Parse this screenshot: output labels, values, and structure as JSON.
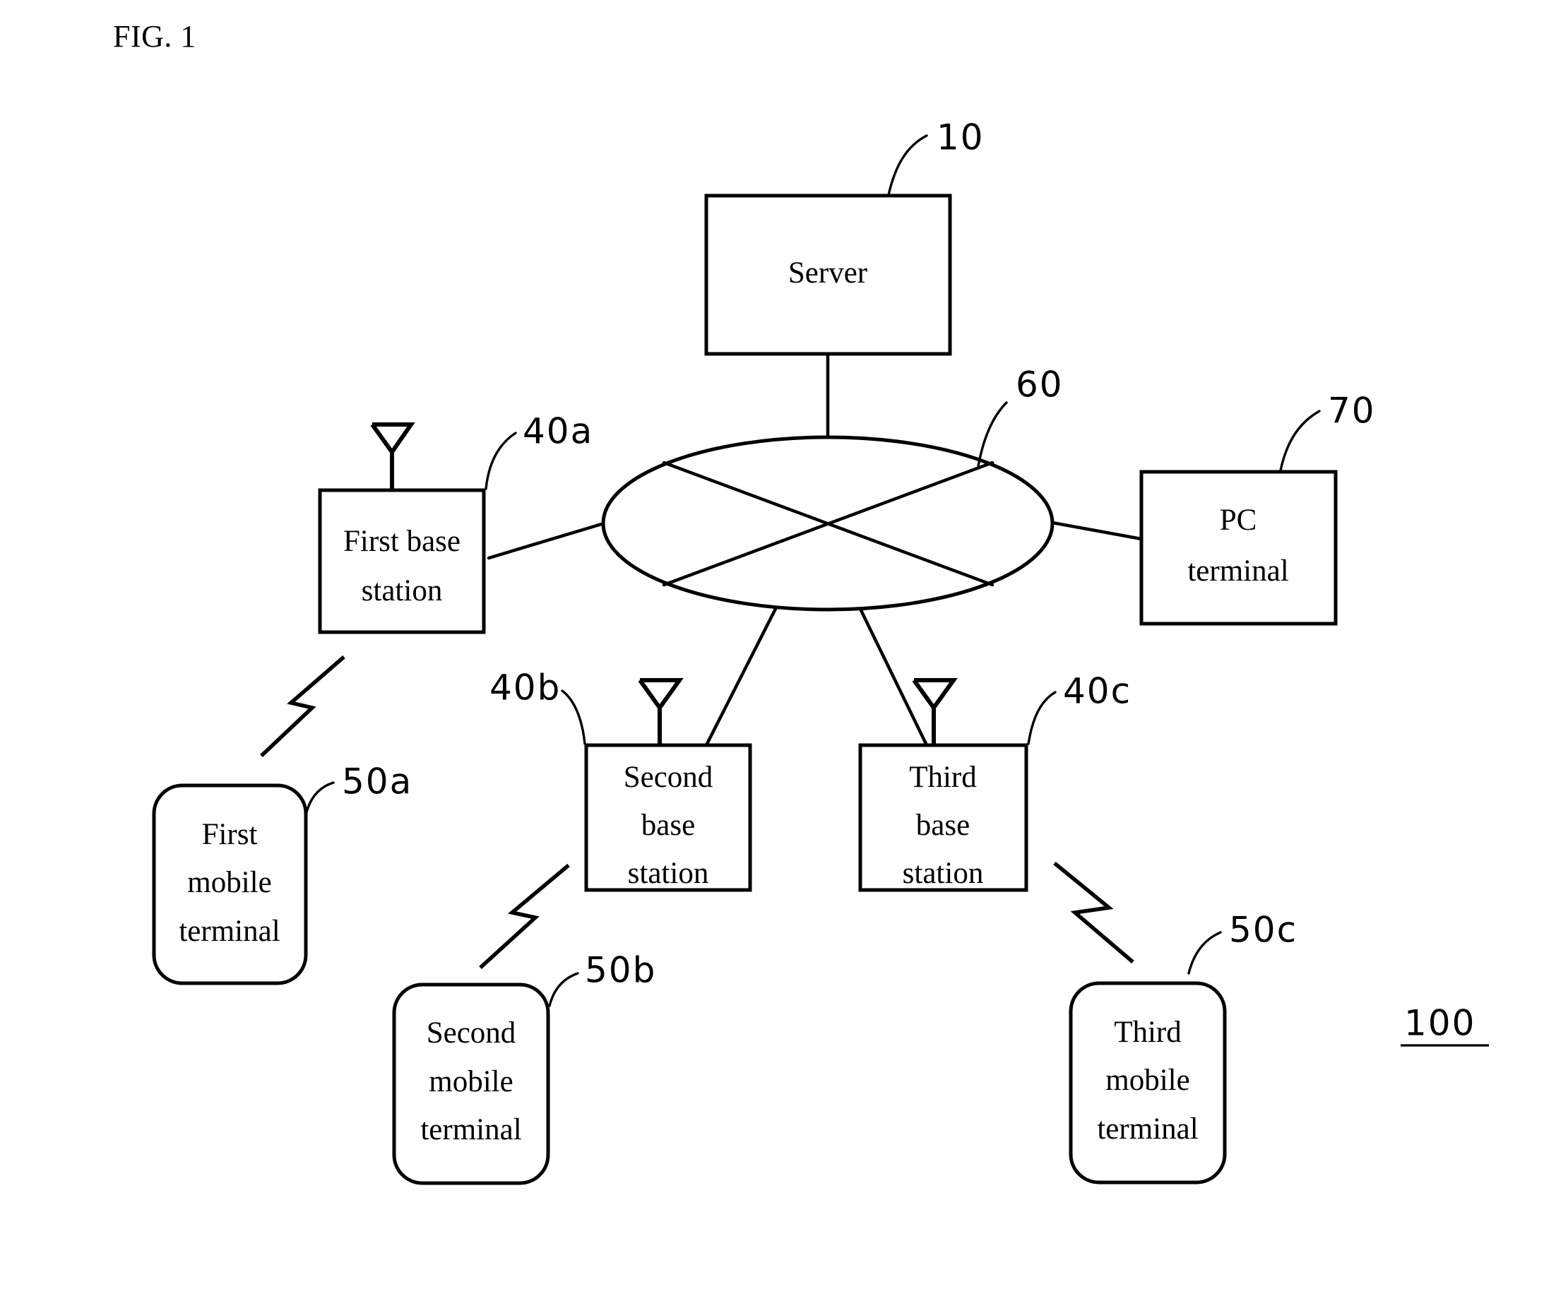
{
  "figure": {
    "title": "FIG. 1",
    "system_ref": "100"
  },
  "nodes": {
    "server": {
      "label": "Server",
      "ref": "10",
      "lines": [
        "Server"
      ],
      "shape": "rectangle"
    },
    "network": {
      "ref": "60",
      "shape": "ellipse-with-cross",
      "icon": "network-cloud-icon"
    },
    "pc_terminal": {
      "ref": "70",
      "lines": [
        "PC",
        "terminal"
      ],
      "shape": "rectangle"
    },
    "first_base_station": {
      "ref": "40a",
      "lines": [
        "First base",
        "station"
      ],
      "shape": "rectangle",
      "icon": "antenna-icon"
    },
    "second_base_station": {
      "ref": "40b",
      "lines": [
        "Second",
        "base",
        "station"
      ],
      "shape": "rectangle",
      "icon": "antenna-icon"
    },
    "third_base_station": {
      "ref": "40c",
      "lines": [
        "Third",
        "base",
        "station"
      ],
      "shape": "rectangle",
      "icon": "antenna-icon"
    },
    "first_mobile_terminal": {
      "ref": "50a",
      "lines": [
        "First",
        "mobile",
        "terminal"
      ],
      "shape": "rounded-rectangle"
    },
    "second_mobile_terminal": {
      "ref": "50b",
      "lines": [
        "Second",
        "mobile",
        "terminal"
      ],
      "shape": "rounded-rectangle"
    },
    "third_mobile_terminal": {
      "ref": "50c",
      "lines": [
        "Third",
        "mobile",
        "terminal"
      ],
      "shape": "rounded-rectangle"
    }
  },
  "connections": [
    {
      "from": "server",
      "to": "network",
      "type": "wired"
    },
    {
      "from": "network",
      "to": "first_base_station",
      "type": "wired"
    },
    {
      "from": "network",
      "to": "pc_terminal",
      "type": "wired"
    },
    {
      "from": "network",
      "to": "second_base_station",
      "type": "wired"
    },
    {
      "from": "network",
      "to": "third_base_station",
      "type": "wired"
    },
    {
      "from": "first_base_station",
      "to": "first_mobile_terminal",
      "type": "wireless"
    },
    {
      "from": "second_base_station",
      "to": "second_mobile_terminal",
      "type": "wireless"
    },
    {
      "from": "third_base_station",
      "to": "third_mobile_terminal",
      "type": "wireless"
    }
  ],
  "colors": {
    "stroke": "#000000",
    "fill": "#ffffff",
    "background": "#ffffff"
  }
}
